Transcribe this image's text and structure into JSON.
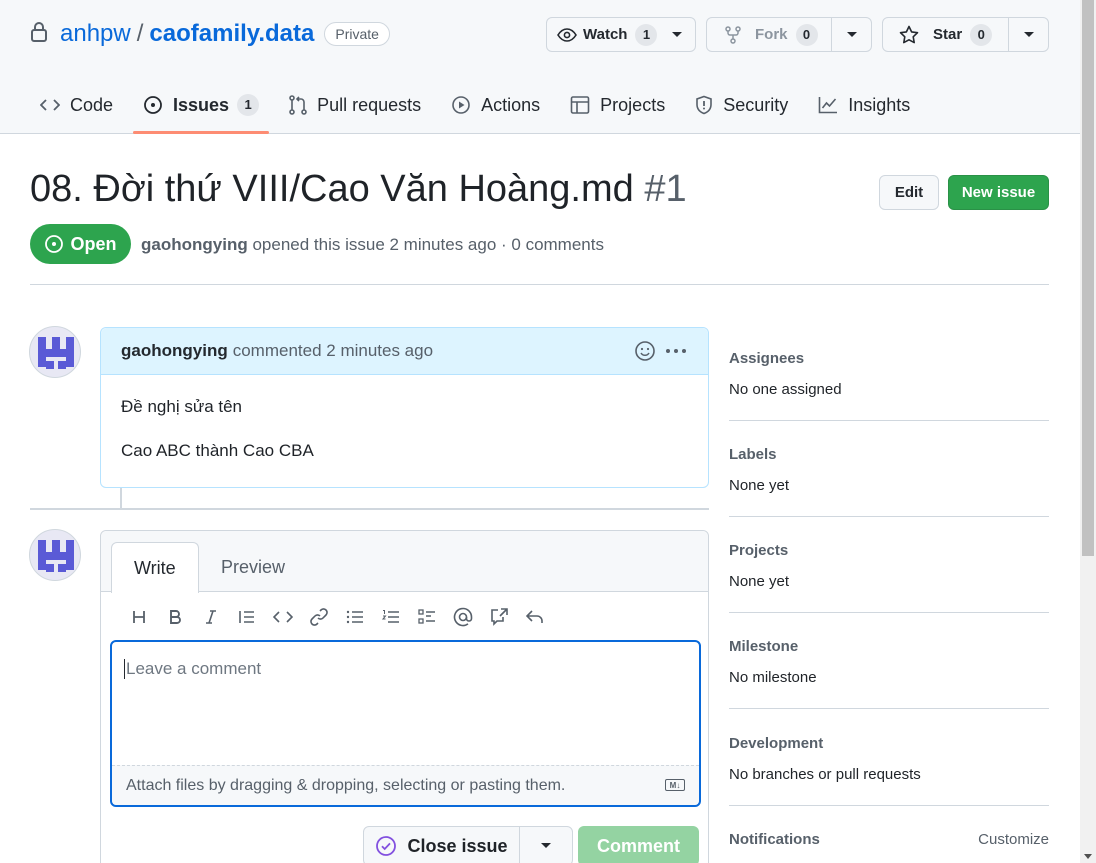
{
  "repo": {
    "owner": "anhpw",
    "separator": "/",
    "name": "caofamily.data",
    "visibility": "Private"
  },
  "header_buttons": {
    "watch": {
      "label": "Watch",
      "count": "1"
    },
    "fork": {
      "label": "Fork",
      "count": "0"
    },
    "star": {
      "label": "Star",
      "count": "0"
    }
  },
  "tabs": [
    {
      "label": "Code"
    },
    {
      "label": "Issues",
      "count": "1"
    },
    {
      "label": "Pull requests"
    },
    {
      "label": "Actions"
    },
    {
      "label": "Projects"
    },
    {
      "label": "Security"
    },
    {
      "label": "Insights"
    }
  ],
  "issue": {
    "title": "08. Đời thứ VIII/Cao Văn Hoàng.md",
    "number": "#1",
    "state": "Open",
    "author": "gaohongying",
    "meta": "opened this issue 2 minutes ago · 0 comments",
    "edit_label": "Edit",
    "new_issue_label": "New issue"
  },
  "comment": {
    "author": "gaohongying",
    "meta": "commented 2 minutes ago",
    "body": [
      "Đề nghị sửa tên",
      "Cao ABC thành Cao CBA"
    ]
  },
  "editor": {
    "tab_write": "Write",
    "tab_preview": "Preview",
    "placeholder": "Leave a comment",
    "attach_text": "Attach files by dragging & dropping, selecting or pasting them.",
    "markdown_badge": "M↓",
    "close_issue_label": "Close issue",
    "comment_label": "Comment"
  },
  "sidebar": {
    "assignees": {
      "heading": "Assignees",
      "value": "No one assigned"
    },
    "labels": {
      "heading": "Labels",
      "value": "None yet"
    },
    "projects": {
      "heading": "Projects",
      "value": "None yet"
    },
    "milestone": {
      "heading": "Milestone",
      "value": "No milestone"
    },
    "development": {
      "heading": "Development",
      "value": "No branches or pull requests"
    },
    "notifications": {
      "heading": "Notifications",
      "customize": "Customize"
    }
  },
  "colors": {
    "link": "#0969da",
    "open_green": "#2da44e",
    "tab_underline": "#fd8c73",
    "comment_header": "#ddf4ff",
    "avatar_purple": "#5a5ad6"
  }
}
